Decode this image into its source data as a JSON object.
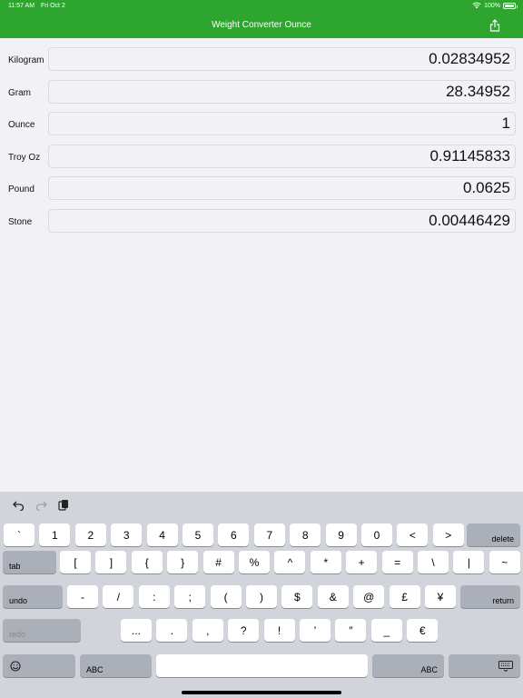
{
  "status": {
    "time": "11:57 AM",
    "date": "Fri Oct 2",
    "battery": "100%"
  },
  "nav": {
    "title": "Weight Converter Ounce"
  },
  "units": [
    {
      "label": "Kilogram",
      "value": "0.02834952"
    },
    {
      "label": "Gram",
      "value": "28.34952"
    },
    {
      "label": "Ounce",
      "value": "1"
    },
    {
      "label": "Troy Oz",
      "value": "0.91145833"
    },
    {
      "label": "Pound",
      "value": "0.0625"
    },
    {
      "label": "Stone",
      "value": "0.00446429"
    }
  ],
  "keyboard": {
    "row1": [
      "`",
      "1",
      "2",
      "3",
      "4",
      "5",
      "6",
      "7",
      "8",
      "9",
      "0",
      "<",
      ">"
    ],
    "delete": "delete",
    "tab": "tab",
    "row2": [
      "[",
      "]",
      "{",
      "}",
      "#",
      "%",
      "^",
      "*",
      "+",
      "=",
      "\\",
      "|",
      "~"
    ],
    "undo": "undo",
    "row3": [
      "-",
      "/",
      ":",
      ";",
      "(",
      ")",
      "$",
      "&",
      "@",
      "£",
      "¥"
    ],
    "return": "return",
    "redo": "redo",
    "row4": [
      "...",
      ".",
      ",",
      "?",
      "!",
      "’",
      "″",
      "_",
      "€"
    ],
    "abc_left": "ABC",
    "abc_right": "ABC"
  },
  "icons": {
    "share": "share-icon",
    "undo": "undo-arrow-icon",
    "redo": "redo-arrow-icon",
    "paste": "clipboard-icon",
    "emoji": "emoji-icon",
    "dismiss": "keyboard-dismiss-icon"
  },
  "colors": {
    "accent": "#2ea52e",
    "background": "#f2f2f6",
    "keyboard": "#d1d4da"
  }
}
